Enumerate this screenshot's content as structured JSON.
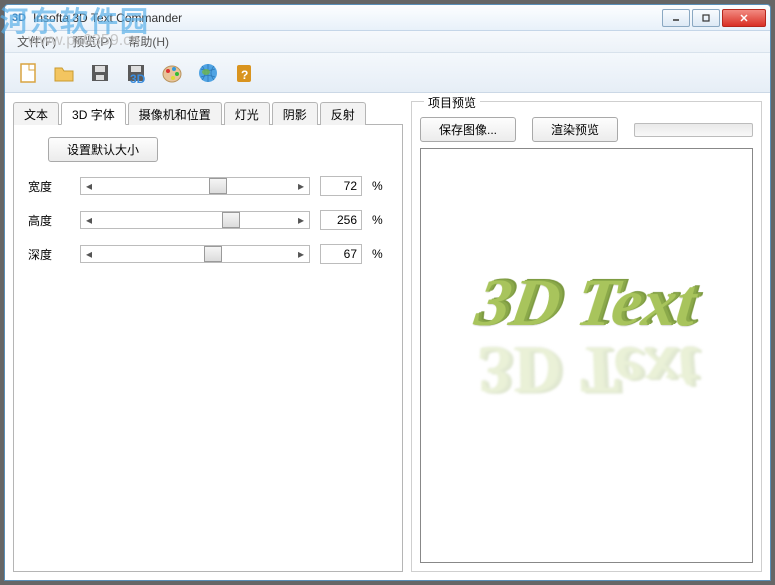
{
  "window": {
    "title": "Insofta 3D Text Commander"
  },
  "menus": {
    "file": "文件(F)",
    "preview": "预览(P)",
    "help": "帮助(H)"
  },
  "toolbar_icons": [
    "new",
    "open",
    "save",
    "3d-save",
    "palette",
    "globe",
    "help"
  ],
  "tabs": {
    "text": "文本",
    "font3d": "3D 字体",
    "camera": "摄像机和位置",
    "light": "灯光",
    "shadow": "阴影",
    "reflect": "反射"
  },
  "set_default": "设置默认大小",
  "sliders": {
    "width": {
      "label": "宽度",
      "value": 72,
      "max": 300
    },
    "height": {
      "label": "高度",
      "value": 256,
      "max": 300
    },
    "depth": {
      "label": "深度",
      "value": 67,
      "max": 300
    }
  },
  "unit": "%",
  "preview_group": "项目预览",
  "save_image": "保存图像...",
  "render_preview": "渲染预览",
  "preview_text": "3D Text",
  "watermark": {
    "brand": "河东软件园",
    "url": "www.pc0359.cn"
  }
}
